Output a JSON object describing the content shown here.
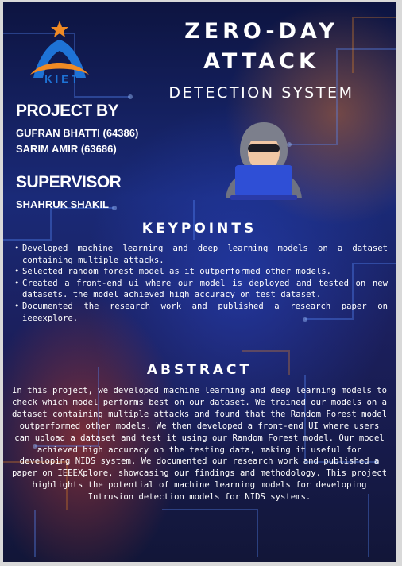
{
  "header": {
    "logo_text": "KIET",
    "title_line1": "ZERO-DAY",
    "title_line2": "ATTACK",
    "subtitle": "DETECTION SYSTEM"
  },
  "project": {
    "heading": "PROJECT BY",
    "members": [
      "GUFRAN BHATTI (64386)",
      "SARIM AMIR (63686)"
    ]
  },
  "supervisor": {
    "heading": "SUPERVISOR",
    "name": "SHAHRUK SHAKIL"
  },
  "keypoints": {
    "heading": "KEYPOINTS",
    "items": [
      "Developed machine learning and deep learning models on a dataset containing multiple attacks.",
      "Selected random forest model as it outperformed other models.",
      "Created a front-end ui where our model is deployed and tested on new datasets. the model achieved high accuracy on test dataset.",
      "Documented the research work and published a research paper on ieeexplore."
    ]
  },
  "abstract": {
    "heading": "ABSTRACT",
    "text": "In this project, we developed machine learning and deep learning models to check which model performs best on our dataset. We trained our models on a dataset containing multiple attacks and found that the Random Forest model outperformed other models. We then developed a front-end UI where users can upload a dataset and test it using our Random Forest model. Our model achieved high accuracy on the testing data, making it useful for developing NIDS system. We documented our research work and published a paper on IEEEXplore, showcasing our findings and methodology. This project highlights the potential of machine learning models for developing Intrusion detection models for NIDS systems."
  },
  "colors": {
    "accent_orange": "#f08a24",
    "logo_blue": "#1e73d6",
    "laptop_blue": "#2f4fd6"
  }
}
